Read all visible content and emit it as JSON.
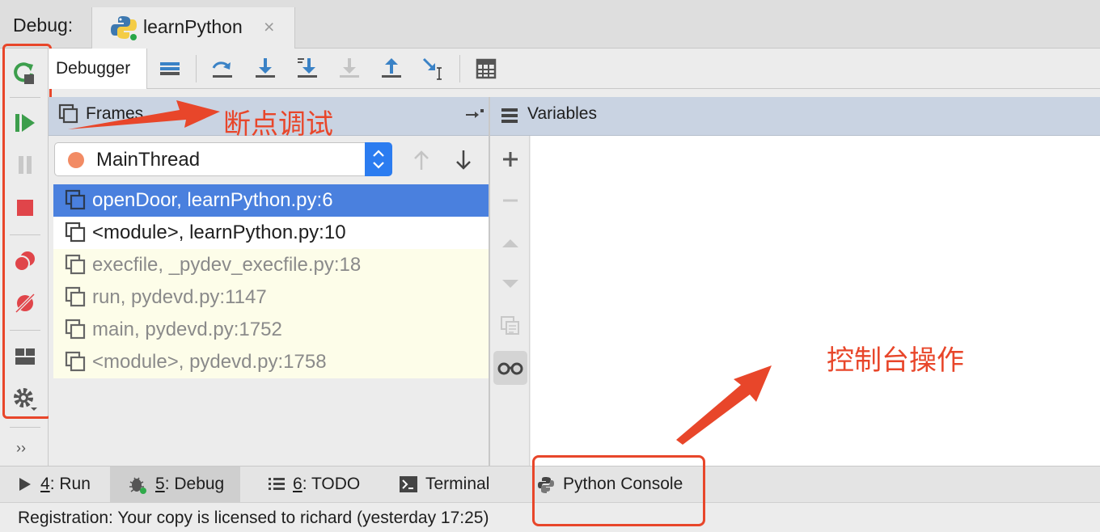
{
  "header": {
    "debug_label": "Debug:",
    "tab_label": "learnPython",
    "tab_close": "×"
  },
  "debugger_tab": {
    "label": "Debugger"
  },
  "frames": {
    "title": "Frames",
    "thread": "MainThread",
    "items": [
      {
        "text": "openDoor, learnPython.py:6"
      },
      {
        "text": "<module>, learnPython.py:10"
      },
      {
        "text": "execfile, _pydev_execfile.py:18"
      },
      {
        "text": "run, pydevd.py:1147"
      },
      {
        "text": "main, pydevd.py:1752"
      },
      {
        "text": "<module>, pydevd.py:1758"
      }
    ]
  },
  "variables": {
    "title": "Variables"
  },
  "left_toolbar": {
    "more": "››"
  },
  "bottom_tabs": [
    {
      "num": "4",
      "label": ": Run"
    },
    {
      "num": "5",
      "label": ": Debug"
    },
    {
      "num": "6",
      "label": ": TODO"
    },
    {
      "label": "Terminal"
    },
    {
      "label": "Python Console"
    }
  ],
  "status": {
    "text": "Registration: Your copy is licensed to richard (yesterday 17:25)"
  },
  "annotations": {
    "breakpoint_debug": "断点调试",
    "console_operation": "控制台操作"
  },
  "colors": {
    "selected_row": "#4a80de",
    "annotation": "#e8462a",
    "library_rows": "#fdfde9",
    "panel_header": "#c9d3e2"
  }
}
